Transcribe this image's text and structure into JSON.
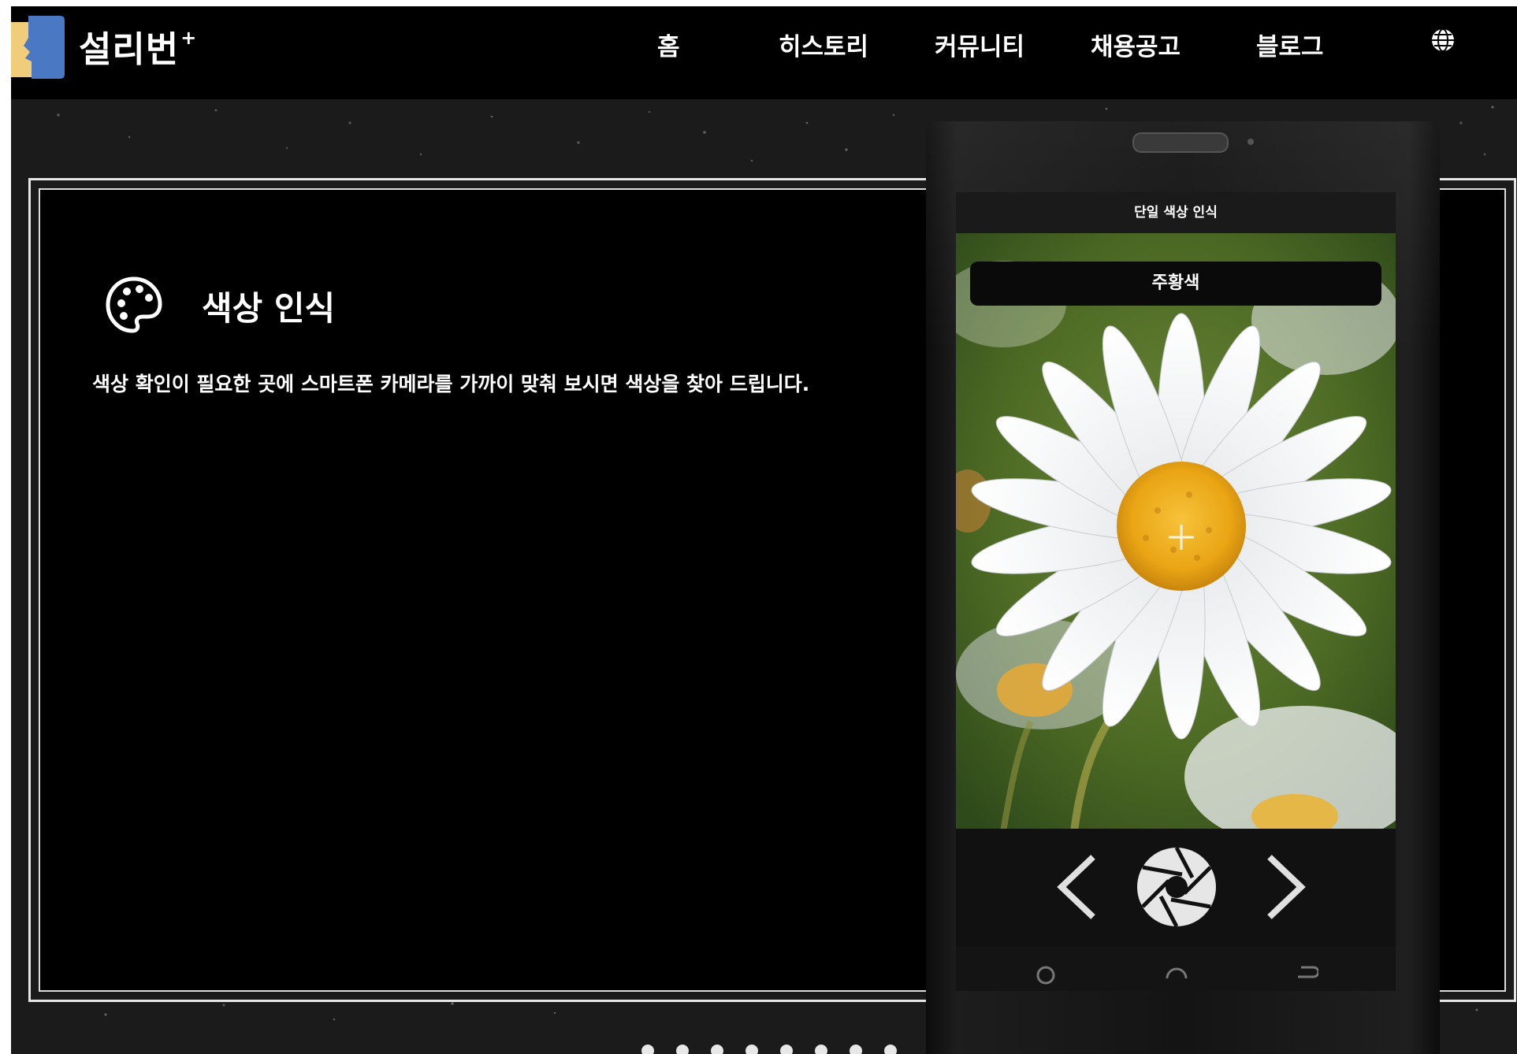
{
  "header": {
    "brand": "설리번",
    "brand_mark": "+",
    "nav": [
      "홈",
      "히스토리",
      "커뮤니티",
      "채용공고",
      "블로그"
    ],
    "globe_icon": "globe-icon",
    "logo_colors": [
      "#f1cc7a",
      "#4a78c2"
    ]
  },
  "feature": {
    "icon": "palette-icon",
    "title": "색상 인식",
    "description": "색상 확인이 필요한 곳에 스마트폰 카메라를 가까이 맞춰 보시면 색상을 찾아 드립니다."
  },
  "phone": {
    "screen_title": "단일 색상 인식",
    "detected_color": "주황색",
    "controls": {
      "prev_icon": "chevron-left-icon",
      "shutter_icon": "camera-shutter-icon",
      "next_icon": "chevron-right-icon"
    }
  },
  "pager": {
    "count": 8
  }
}
